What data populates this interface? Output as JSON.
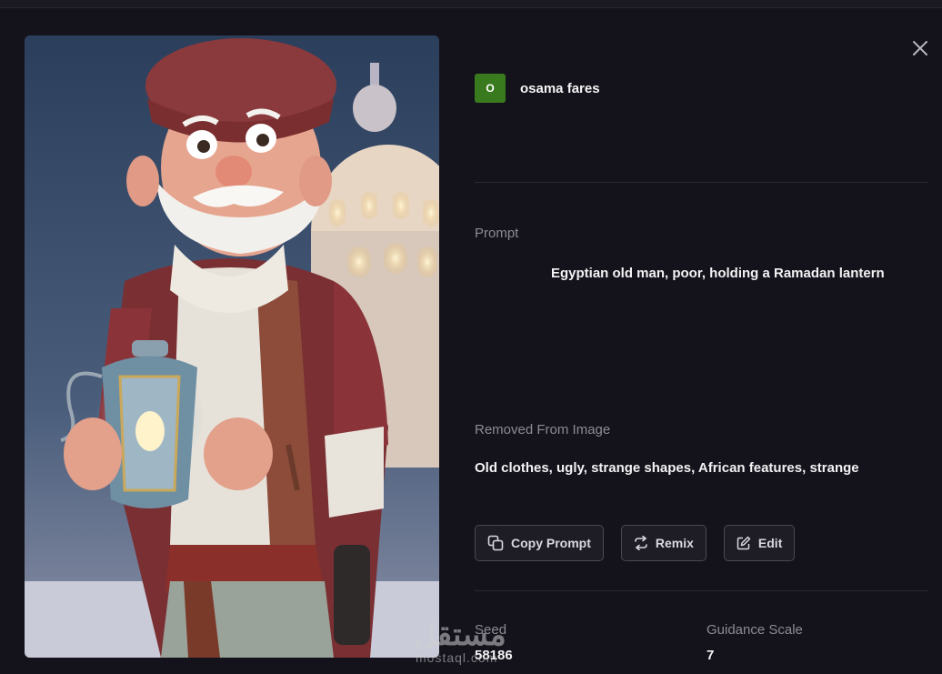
{
  "author": {
    "initial": "O",
    "name": "osama fares",
    "avatar_color": "#3a7a1e"
  },
  "prompt": {
    "label": "Prompt",
    "text": "Egyptian old man, poor, holding a Ramadan lantern"
  },
  "removed": {
    "label": "Removed From Image",
    "text": "Old clothes, ugly, strange shapes, African features, strange"
  },
  "actions": {
    "copy_prompt": "Copy Prompt",
    "remix": "Remix",
    "edit": "Edit"
  },
  "stats": {
    "seed_label": "Seed",
    "seed_value": "58186",
    "guidance_label": "Guidance Scale",
    "guidance_value": "7"
  },
  "watermark": {
    "main": "مستقل",
    "sub": "mostaql.com"
  },
  "icons": {
    "close": "close-icon",
    "copy": "copy-icon",
    "remix": "remix-icon",
    "edit": "edit-icon"
  }
}
